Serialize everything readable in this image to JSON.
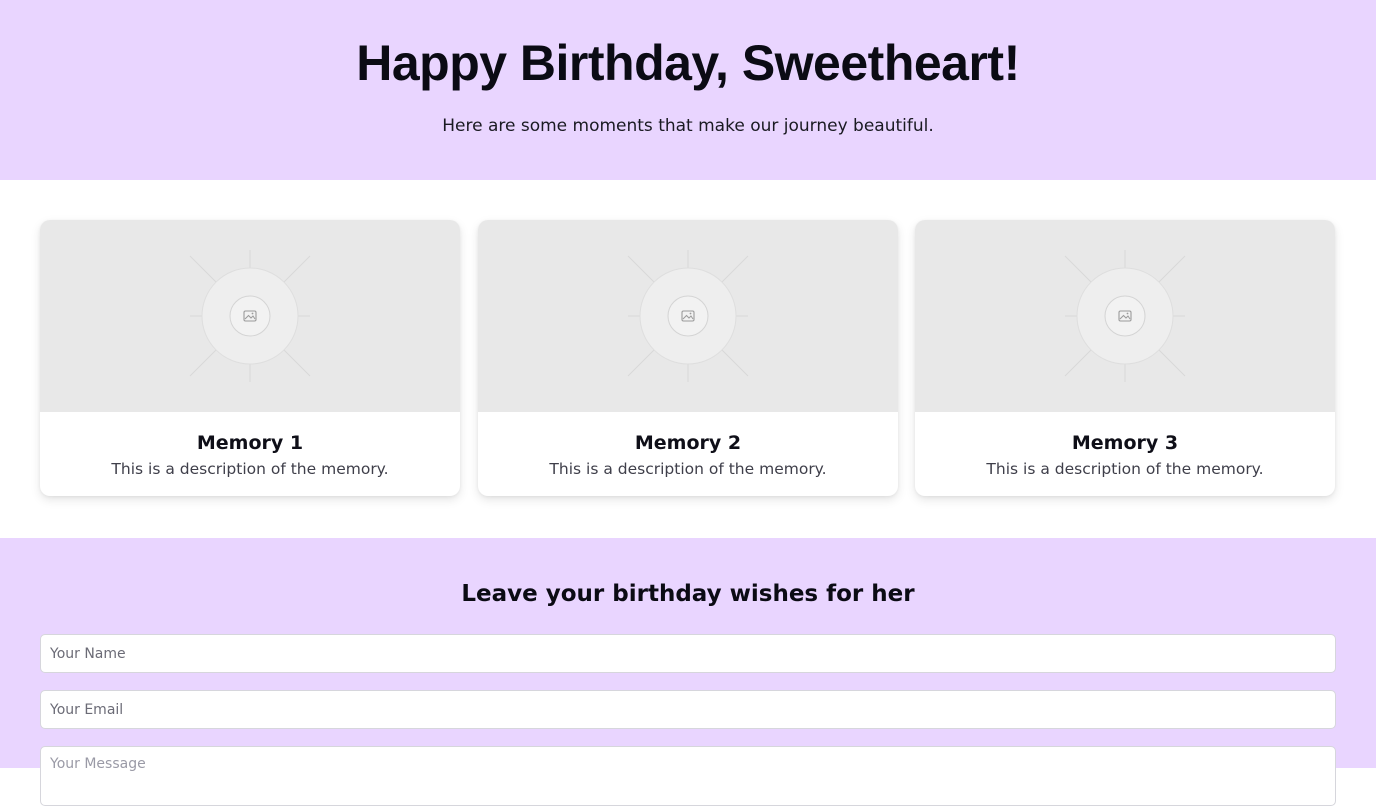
{
  "header": {
    "title": "Happy Birthday, Sweetheart!",
    "subtitle": "Here are some moments that make our journey beautiful."
  },
  "memories": [
    {
      "title": "Memory 1",
      "description": "This is a description of the memory.",
      "image_icon": "image-placeholder-icon"
    },
    {
      "title": "Memory 2",
      "description": "This is a description of the memory.",
      "image_icon": "image-placeholder-icon"
    },
    {
      "title": "Memory 3",
      "description": "This is a description of the memory.",
      "image_icon": "image-placeholder-icon"
    }
  ],
  "wishes": {
    "title": "Leave your birthday wishes for her",
    "name_placeholder": "Your Name",
    "email_placeholder": "Your Email",
    "message_placeholder": "Your Message"
  },
  "colors": {
    "accent_background": "#e9d5ff",
    "card_image_background": "#e8e8e8"
  }
}
